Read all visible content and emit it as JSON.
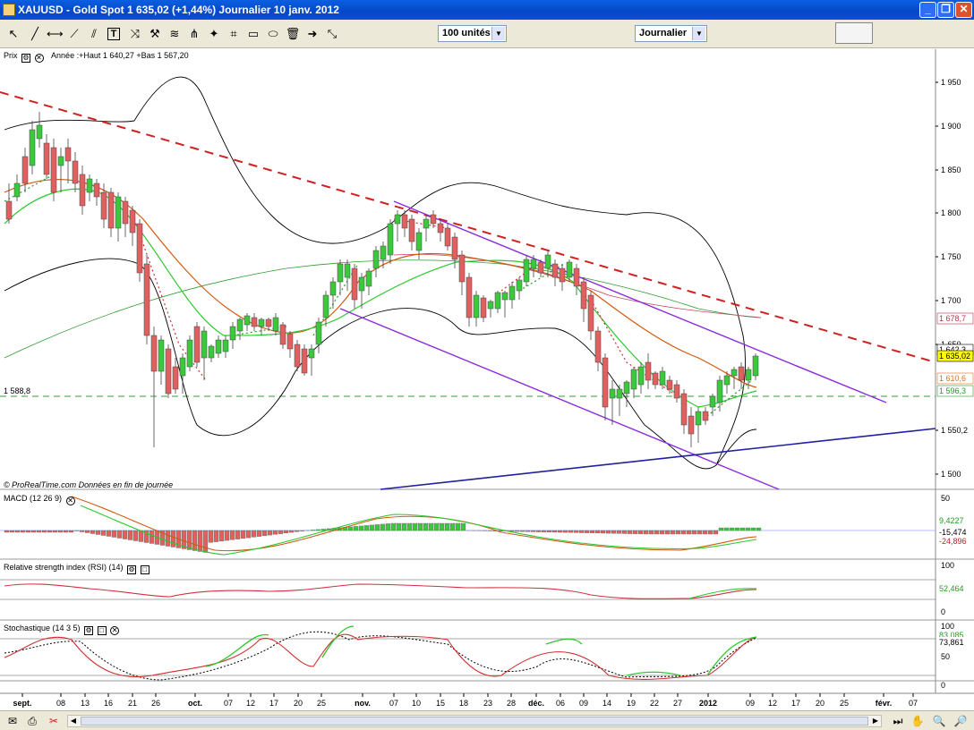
{
  "window": {
    "title": "XAUUSD - Gold Spot    1 635,02 (+1,44%)    Journalier  10 janv. 2012"
  },
  "toolbar": {
    "units_select": "100 unités",
    "period_select": "Journalier",
    "tools": [
      "cursor-icon",
      "line-icon",
      "hline-icon",
      "trendline-icon",
      "text-icon",
      "fibonacci-icon",
      "tools-icon",
      "wave-icon",
      "channel-icon",
      "shape-icon",
      "rect-icon",
      "delete-icon",
      "arrow-icon",
      "zoom-icon"
    ]
  },
  "price_panel": {
    "title": "Prix",
    "info": "Année :+Haut 1 640,27 +Bas 1 567,20",
    "watermark": "© ProRealTime.com  Données en fin de journée",
    "level_label": "1 588,8",
    "axis_ticks": [
      "1 950",
      "1 900",
      "1 850",
      "1 800",
      "1 750",
      "1 700",
      "1 650",
      "1 550,2",
      "1 500"
    ],
    "tags": [
      {
        "text": "1 678,7",
        "color": "#c0304a"
      },
      {
        "text": "1 642,3",
        "color": "#000000"
      },
      {
        "text": "1 635,02",
        "color": "#000000",
        "bg": "#ffff00"
      },
      {
        "text": "1 610,6",
        "color": "#e07020"
      },
      {
        "text": "1 596,3",
        "color": "#20a020"
      }
    ]
  },
  "macd_panel": {
    "title": "MACD (12 26 9)",
    "ticks": [
      "50"
    ],
    "tags": [
      {
        "text": "9,4227",
        "color": "#20a020"
      },
      {
        "text": "-15,474",
        "color": "#000000"
      },
      {
        "text": "-24,896",
        "color": "#c02020"
      }
    ]
  },
  "rsi_panel": {
    "title": "Relative strength index (RSI) (14)",
    "ticks": [
      "100",
      "0"
    ],
    "tags": [
      {
        "text": "52,464",
        "color": "#20a020"
      }
    ]
  },
  "stoch_panel": {
    "title": "Stochastique (14 3 5)",
    "ticks": [
      "100",
      "50",
      "0"
    ],
    "tags": [
      {
        "text": "83,085",
        "color": "#20a020"
      },
      {
        "text": "73,861",
        "color": "#000000"
      }
    ]
  },
  "time_axis": [
    "sept.",
    "08",
    "13",
    "16",
    "21",
    "26",
    "oct.",
    "07",
    "12",
    "17",
    "20",
    "25",
    "nov.",
    "07",
    "10",
    "15",
    "18",
    "23",
    "28",
    "déc.",
    "06",
    "09",
    "14",
    "19",
    "22",
    "27",
    "2012",
    "09",
    "12",
    "17",
    "20",
    "25",
    "févr.",
    "07"
  ],
  "colors": {
    "up": "#3cc83c",
    "down": "#e06060",
    "resistance": "#d02020",
    "channel": "#8a2be2",
    "support": "#2020a0"
  }
}
